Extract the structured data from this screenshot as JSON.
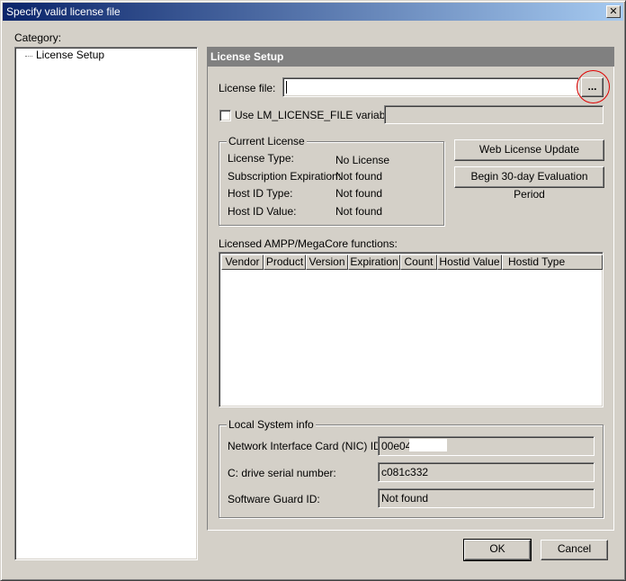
{
  "window": {
    "title": "Specify valid license file",
    "close_glyph": "✕"
  },
  "category": {
    "label": "Category:",
    "items": [
      {
        "label": "License Setup"
      }
    ]
  },
  "panel": {
    "header": "License Setup",
    "license_file": {
      "label": "License file:",
      "value": "",
      "browse_label": "..."
    },
    "use_lm_variable": {
      "label": "Use LM_LICENSE_FILE variable:",
      "checked": false,
      "value": ""
    },
    "current_license": {
      "legend": "Current License",
      "rows": [
        {
          "label": "License Type:",
          "value": "No License"
        },
        {
          "label": "Subscription Expiration:",
          "value": "Not found"
        },
        {
          "label": "Host ID Type:",
          "value": "Not found"
        },
        {
          "label": "Host ID Value:",
          "value": "Not found"
        }
      ]
    },
    "web_license_update_label": "Web License Update",
    "evaluation_label": "Begin 30-day Evaluation Period",
    "licensed_functions": {
      "label": "Licensed AMPP/MegaCore functions:",
      "columns": [
        "Vendor",
        "Product",
        "Version",
        "Expiration",
        "Count",
        "Hostid Value",
        "Hostid Type"
      ],
      "rows": []
    },
    "local_system": {
      "legend": "Local System info",
      "rows": [
        {
          "label": "Network Interface Card (NIC) ID:",
          "value": "00e04"
        },
        {
          "label": "C: drive serial number:",
          "value": "c081c332"
        },
        {
          "label": "Software Guard ID:",
          "value": "Not found"
        }
      ]
    }
  },
  "footer": {
    "ok_label": "OK",
    "cancel_label": "Cancel"
  },
  "colors": {
    "window_bg": "#d4d0c8",
    "titlebar": "#0a246a",
    "panel_header": "#808080",
    "highlight_circle": "#e00000"
  }
}
